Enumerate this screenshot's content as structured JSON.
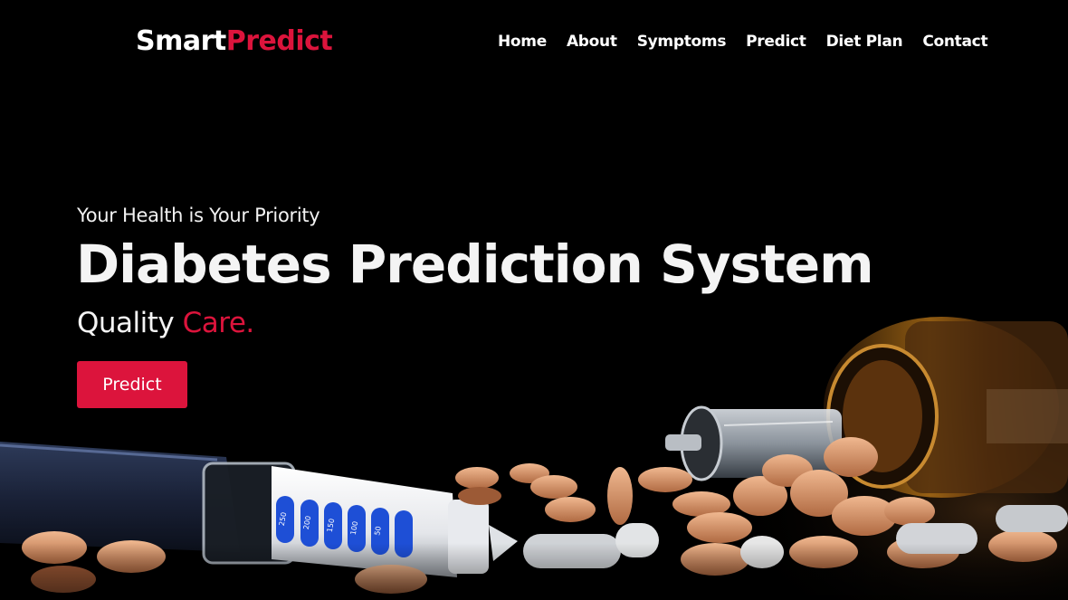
{
  "brand": {
    "part1": "Smart",
    "part2": "Predict"
  },
  "nav": [
    "Home",
    "About",
    "Symptoms",
    "Predict",
    "Diet Plan",
    "Contact"
  ],
  "hero": {
    "tagline": "Your Health is Your Priority",
    "title": "Diabetes Prediction System",
    "subtitle_lead": "Quality",
    "subtitle_accent": "Care.",
    "cta_label": "Predict"
  },
  "pen_scale": [
    "250",
    "200",
    "150",
    "100",
    "50"
  ],
  "colors": {
    "accent": "#dc143c",
    "background": "#000000"
  },
  "icons": [
    "insulin-pen-illustration",
    "syringe-illustration",
    "pill-bottle-illustration",
    "pills-illustration"
  ]
}
